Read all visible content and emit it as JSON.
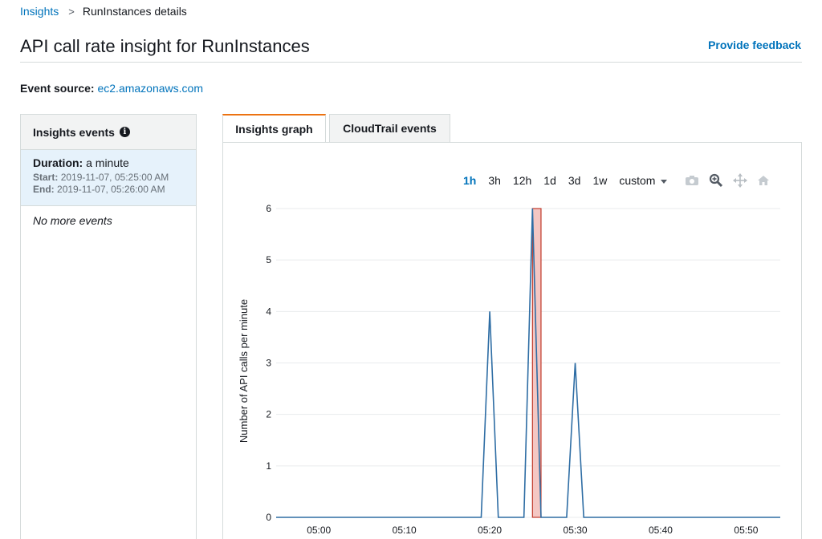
{
  "breadcrumb": {
    "root": "Insights",
    "separator": ">",
    "current": "RunInstances details"
  },
  "header": {
    "title": "API call rate insight for RunInstances",
    "feedback": "Provide feedback"
  },
  "event_source": {
    "label": "Event source:",
    "value": "ec2.amazonaws.com"
  },
  "insights_panel": {
    "title": "Insights events",
    "event": {
      "duration_label": "Duration:",
      "duration_value": "a minute",
      "start_label": "Start:",
      "start_value": "2019-11-07, 05:25:00 AM",
      "end_label": "End:",
      "end_value": "2019-11-07, 05:26:00 AM"
    },
    "no_more": "No more events"
  },
  "tabs": [
    {
      "label": "Insights graph",
      "active": true
    },
    {
      "label": "CloudTrail events",
      "active": false
    }
  ],
  "time_range": {
    "options": [
      "1h",
      "3h",
      "12h",
      "1d",
      "3d",
      "1w"
    ],
    "selected": "1h",
    "custom": "custom"
  },
  "toolbar": [
    "camera-icon",
    "zoom-icon",
    "pan-icon",
    "home-icon"
  ],
  "colors": {
    "link": "#0073bb",
    "line": "#2e6da4",
    "highlight_fill": "#f4c7c3",
    "highlight_stroke": "#c0392b",
    "tab_accent": "#ec7211"
  },
  "chart_data": {
    "type": "line",
    "ylabel": "Number of API calls per minute",
    "xlabel": "",
    "x_ticks": [
      "05:00",
      "05:10",
      "05:20",
      "05:30",
      "05:40",
      "05:50"
    ],
    "y_ticks": [
      0,
      1,
      2,
      3,
      4,
      5,
      6
    ],
    "xlim": [
      "04:55",
      "05:54"
    ],
    "ylim": [
      0,
      6
    ],
    "grid": true,
    "series": [
      {
        "x": [
          "04:55",
          "05:19",
          "05:20",
          "05:21",
          "05:24",
          "05:25",
          "05:26",
          "05:29",
          "05:30",
          "05:31",
          "05:54"
        ],
        "values": [
          0,
          0,
          4,
          0,
          0,
          6,
          0,
          0,
          3,
          0,
          0
        ]
      }
    ],
    "highlight": {
      "x_start": "05:25",
      "x_end": "05:26",
      "value": 6
    }
  }
}
